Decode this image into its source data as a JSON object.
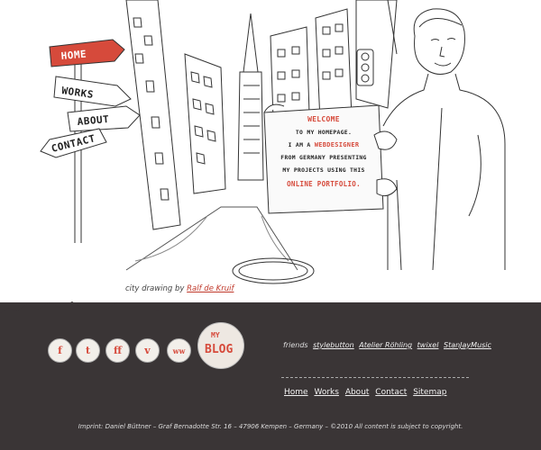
{
  "nav": {
    "home": "HOME",
    "works": "WORKS",
    "about": "ABOUT",
    "contact": "CONTACT"
  },
  "welcome_sign": {
    "line1": "WELCOME",
    "line2": "TO MY HOMEPAGE.",
    "line3a": "I AM A ",
    "line3b": "WEBDESIGNER",
    "line4": "FROM GERMANY PRESENTING",
    "line5": "MY PROJECTS USING THIS",
    "line6": "ONLINE PORTFOLIO."
  },
  "credit": {
    "text": "city drawing by ",
    "author": "Ralf de Kruif"
  },
  "social": {
    "facebook": "f",
    "twitter": "t",
    "flickr": "ff",
    "vimeo": "v",
    "www": "ww"
  },
  "blog": {
    "my": "MY",
    "blog": "BLOG"
  },
  "friends": {
    "label": "friends",
    "links": [
      "stylebutton",
      "Atelier Röhling",
      "twixel",
      "StanJayMusic"
    ]
  },
  "footer_menu": [
    "Home",
    "Works",
    "About",
    "Contact",
    "Sitemap"
  ],
  "imprint": "Imprint: Daniel Büttner – Graf Bernadotte Str. 16 – 47906 Kempen – Germany – ©2010 All content is subject to copyright.",
  "colors": {
    "accent": "#d64a3b",
    "dark": "#3a3536"
  }
}
